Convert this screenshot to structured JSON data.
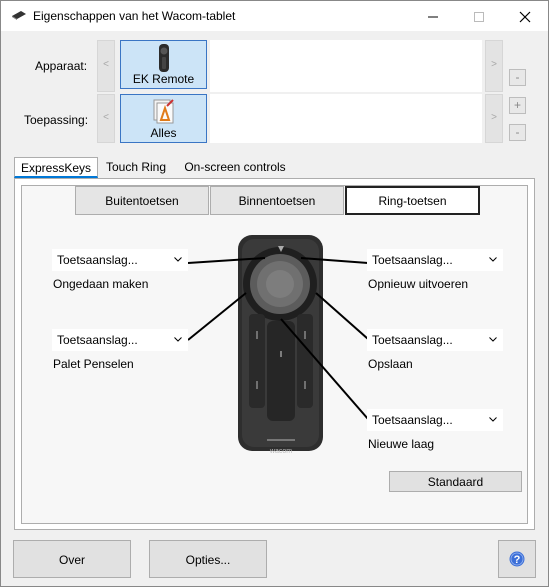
{
  "window": {
    "title": "Eigenschappen van het Wacom-tablet"
  },
  "device": {
    "label": "Apparaat:",
    "nav_prev": "<",
    "nav_next": ">",
    "remove": "-",
    "selected": {
      "name": "EK Remote",
      "icon": "remote-device-icon"
    }
  },
  "application": {
    "label": "Toepassing:",
    "nav_prev": "<",
    "nav_next": ">",
    "add": "+",
    "remove": "-",
    "selected": {
      "name": "Alles",
      "icon": "all-applications-icon"
    }
  },
  "tabs": [
    {
      "label": "ExpressKeys",
      "active": true
    },
    {
      "label": "Touch Ring",
      "active": false
    },
    {
      "label": "On-screen controls",
      "active": false
    }
  ],
  "segments": [
    {
      "label": "Buitentoetsen",
      "active": false
    },
    {
      "label": "Binnentoetsen",
      "active": false
    },
    {
      "label": "Ring-toetsen",
      "active": true
    }
  ],
  "assignments": [
    {
      "value": "Toetsaanslag...",
      "description": "Ongedaan maken"
    },
    {
      "value": "Toetsaanslag...",
      "description": "Palet Penselen"
    },
    {
      "value": "Toetsaanslag...",
      "description": "Opnieuw uitvoeren"
    },
    {
      "value": "Toetsaanslag...",
      "description": "Opslaan"
    },
    {
      "value": "Toetsaanslag...",
      "description": "Nieuwe laag"
    }
  ],
  "remote": {
    "brand": "wacom"
  },
  "buttons": {
    "standard": "Standaard",
    "about": "Over",
    "options": "Opties...",
    "help_icon": "help-icon"
  },
  "colors": {
    "accent": "#0078d7",
    "selection": "#cce4f7",
    "help": "#3c6fd8"
  }
}
